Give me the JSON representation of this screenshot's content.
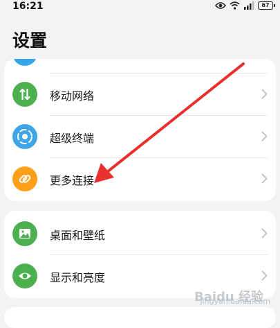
{
  "status_bar": {
    "time": "16:21",
    "battery": "67",
    "icons": [
      "eye-icon",
      "wifi-icon",
      "signal-icon",
      "battery-icon"
    ]
  },
  "page": {
    "title": "设置"
  },
  "groups": [
    {
      "items": [
        {
          "label": "移动网络",
          "icon": "mobile-network-icon",
          "color": "#4caf50"
        },
        {
          "label": "超级终端",
          "icon": "super-device-icon",
          "color": "#3ea6e8"
        },
        {
          "label": "更多连接",
          "icon": "link-icon",
          "color": "#ff9f1a"
        }
      ]
    },
    {
      "items": [
        {
          "label": "桌面和壁纸",
          "icon": "wallpaper-icon",
          "color": "#4caf50"
        },
        {
          "label": "显示和亮度",
          "icon": "display-eye-icon",
          "color": "#4caf50"
        }
      ]
    }
  ],
  "watermark": {
    "text": "Baidu 经验",
    "sub": "jingyan.baidu.com"
  },
  "colors": {
    "background": "#f1f3f5",
    "card": "#ffffff",
    "arrow": "#e8312f"
  }
}
